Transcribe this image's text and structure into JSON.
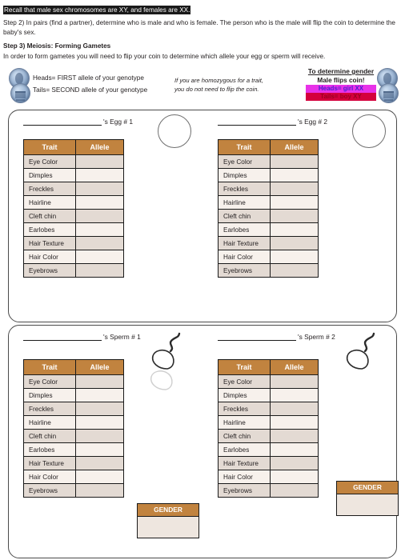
{
  "intro": {
    "highlight": "Recall that male sex chromosomes are XY, and females are XX.",
    "step2": "Step 2) In pairs (find a partner), determine who is male and who is female. The person who is the male will flip the coin to determine the baby's sex.",
    "step3_heading": "Step 3) Meiosis: Forming Gametes",
    "step3_body": "In order to form gametes you will need to flip your coin to determine which allele your egg or sperm will receive."
  },
  "legend": {
    "heads": "Heads= FIRST allele of your genotype",
    "tails": "Tails= SECOND allele of your genotype",
    "note_line1": "If you are homozygous for a trait,",
    "note_line2": "you do not need to flip the coin.",
    "gender_key": {
      "title": "To determine gender",
      "subtitle": "Male flips coin!",
      "girl": "Heads=  girl  XX",
      "boy": "Tails= boy  XY"
    },
    "coin_heads_label": "heads",
    "coin_tails_label": "tails"
  },
  "table": {
    "headers": [
      "Trait",
      "Allele"
    ],
    "traits": [
      "Eye Color",
      "Dimples",
      "Freckles",
      "Hairline",
      "Cleft chin",
      "Earlobes",
      "Hair Texture",
      "Hair Color",
      "Eyebrows"
    ]
  },
  "gametes": {
    "egg1": {
      "blank": "",
      "suffix": "'s Egg # 1"
    },
    "egg2": {
      "blank": "",
      "suffix": "'s Egg # 2"
    },
    "sperm1": {
      "blank": "",
      "suffix": "'s Sperm # 1"
    },
    "sperm2": {
      "blank": "",
      "suffix": "'s Sperm # 2"
    }
  },
  "gender_boxes": {
    "box1_label": "GENDER",
    "box2_label": "GENDER"
  },
  "colors": {
    "header_brown": "#C1833F",
    "row_dark": "#E3DAD3",
    "row_light": "#F7F1EC",
    "highlight_black": "#1A1A1A",
    "girl_magenta": "#E832E8",
    "boy_red": "#D4003C",
    "coin_blue": "#9DB6D4"
  }
}
